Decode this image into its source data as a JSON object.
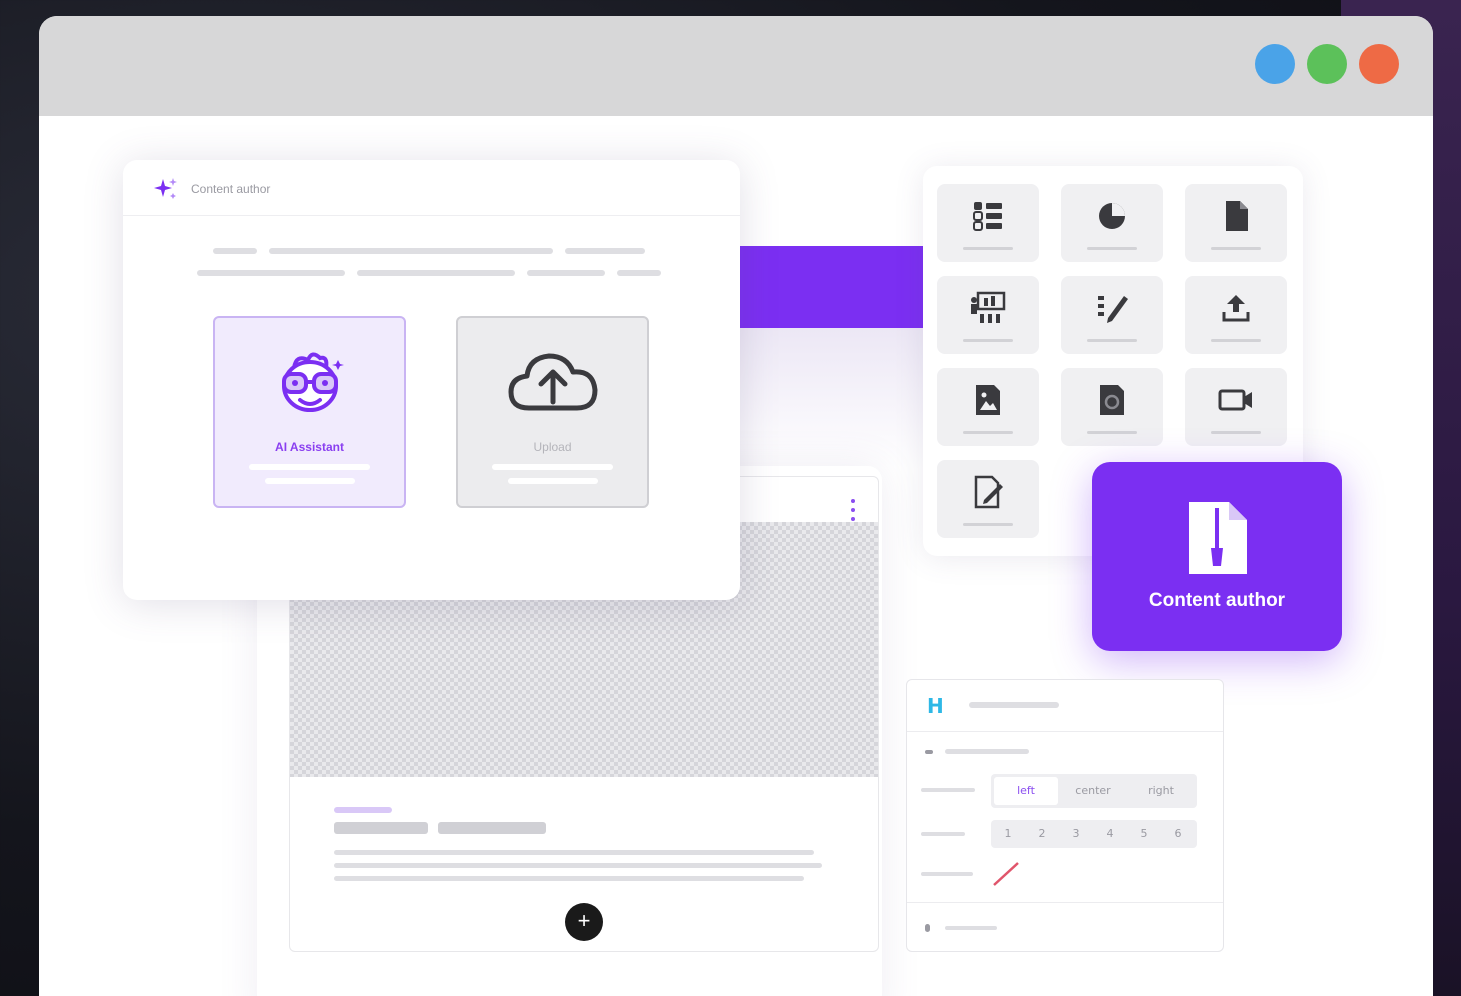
{
  "window": {
    "controls": [
      "blue-dot",
      "green-dot",
      "red-dot"
    ],
    "colors": {
      "blue": "#4aa3e8",
      "green": "#5cc15a",
      "red": "#ee6a45",
      "accent": "#7b2ff2"
    }
  },
  "dialog": {
    "title": "Content author",
    "options": [
      {
        "label": "AI Assistant",
        "icon": "robot-with-glasses-icon"
      },
      {
        "label": "Upload",
        "icon": "cloud-upload-icon"
      }
    ]
  },
  "tools": {
    "tiles": [
      {
        "icon": "list-icon"
      },
      {
        "icon": "pie-chart-icon"
      },
      {
        "icon": "document-icon"
      },
      {
        "icon": "presentation-icon"
      },
      {
        "icon": "edit-pen-icon"
      },
      {
        "icon": "upload-icon"
      },
      {
        "icon": "image-file-icon"
      },
      {
        "icon": "link-file-icon"
      },
      {
        "icon": "video-icon"
      },
      {
        "icon": "edit-document-icon"
      }
    ]
  },
  "content_author_button": {
    "label": "Content author",
    "icon": "document-brush-icon"
  },
  "props": {
    "heading_icon": "H",
    "align_options": [
      "left",
      "center",
      "right"
    ],
    "levels": [
      "1",
      "2",
      "3",
      "4",
      "5",
      "6"
    ]
  },
  "editor": {
    "add_label": "+"
  }
}
